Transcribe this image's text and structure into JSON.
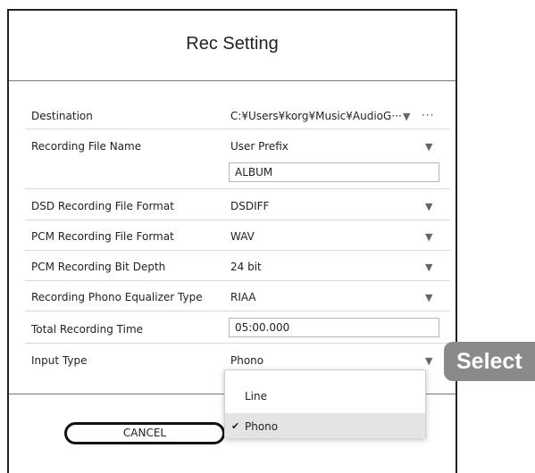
{
  "dialog": {
    "title": "Rec Setting",
    "settings": [
      {
        "label": "Destination",
        "value": "C:¥Users¥korg¥Music¥AudioG···",
        "control": "dropdown-browse"
      },
      {
        "label": "Recording File Name",
        "value": "User Prefix",
        "control": "dropdown",
        "input_value": "ALBUM"
      },
      {
        "label": "DSD Recording File Format",
        "value": "DSDIFF",
        "control": "dropdown"
      },
      {
        "label": "PCM Recording File Format",
        "value": "WAV",
        "control": "dropdown"
      },
      {
        "label": "PCM Recording Bit Depth",
        "value": "24 bit",
        "control": "dropdown"
      },
      {
        "label": "Recording Phono Equalizer Type",
        "value": "RIAA",
        "control": "dropdown"
      },
      {
        "label": "Total Recording Time",
        "input_value": "05:00.000",
        "control": "text-input"
      },
      {
        "label": "Input Type",
        "value": "Phono",
        "control": "dropdown"
      }
    ],
    "dropdown_arrow": "▼",
    "browse_label": "···",
    "cancel_label": "CANCEL"
  },
  "input_type_menu": {
    "options": [
      {
        "label": "Line",
        "selected": false
      },
      {
        "label": "Phono",
        "selected": true
      }
    ],
    "check_mark": "✔"
  },
  "callout": {
    "text": "Select"
  },
  "colors": {
    "border": "#222222",
    "selected_option_bg": "#e4e4e4",
    "callout_bg": "#8a8a8a"
  }
}
